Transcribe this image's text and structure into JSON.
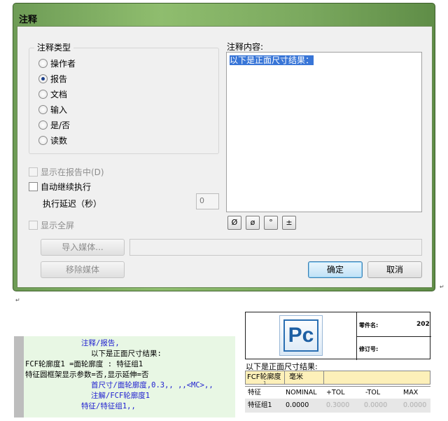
{
  "dialog": {
    "title": "注释",
    "type_group_label": "注释类型",
    "types": [
      "操作者",
      "报告",
      "文档",
      "输入",
      "是/否",
      "读数"
    ],
    "selected_type": "报告",
    "show_in_report_label": "显示在报告中(D)",
    "auto_continue_label": "自动继续执行",
    "delay_label": "执行延迟（秒）",
    "delay_value": "0",
    "fullscreen_label": "显示全屏",
    "content_label": "注释内容:",
    "content_text": "以下是正面尺寸结果：",
    "symbols": [
      "Ø",
      "ø",
      "°",
      "±"
    ],
    "import_media": "导入媒体...",
    "remove_media": "移除媒体",
    "ok": "确定",
    "cancel": "取消"
  },
  "code": {
    "lines": [
      "注释/报告,",
      "以下是正面尺寸结果:",
      "FCF轮廓度1 =面轮廓度 : 特征组1",
      "特征圆框架显示参数=否,显示延伸=否",
      "首尺寸/面轮廓度,0.3,, ,,<MC>,,",
      "注解/FCF轮廓度1",
      "特征/特征组1,,"
    ]
  },
  "report": {
    "logo": "Pc",
    "part_name_label": "零件名:",
    "part_name_value": "202",
    "revision_label": "修订号:",
    "result_text": "以下是正面尺寸结果:",
    "fcf_name": "FCF轮廓度",
    "fcf_sub": "1",
    "unit": "毫米",
    "columns": [
      "特征",
      "NOMINAL",
      "+TOL",
      "-TOL",
      "MAX"
    ],
    "row": [
      "特征组1",
      "0.0000",
      "0.3000",
      "0.0000",
      "0.0000"
    ]
  }
}
